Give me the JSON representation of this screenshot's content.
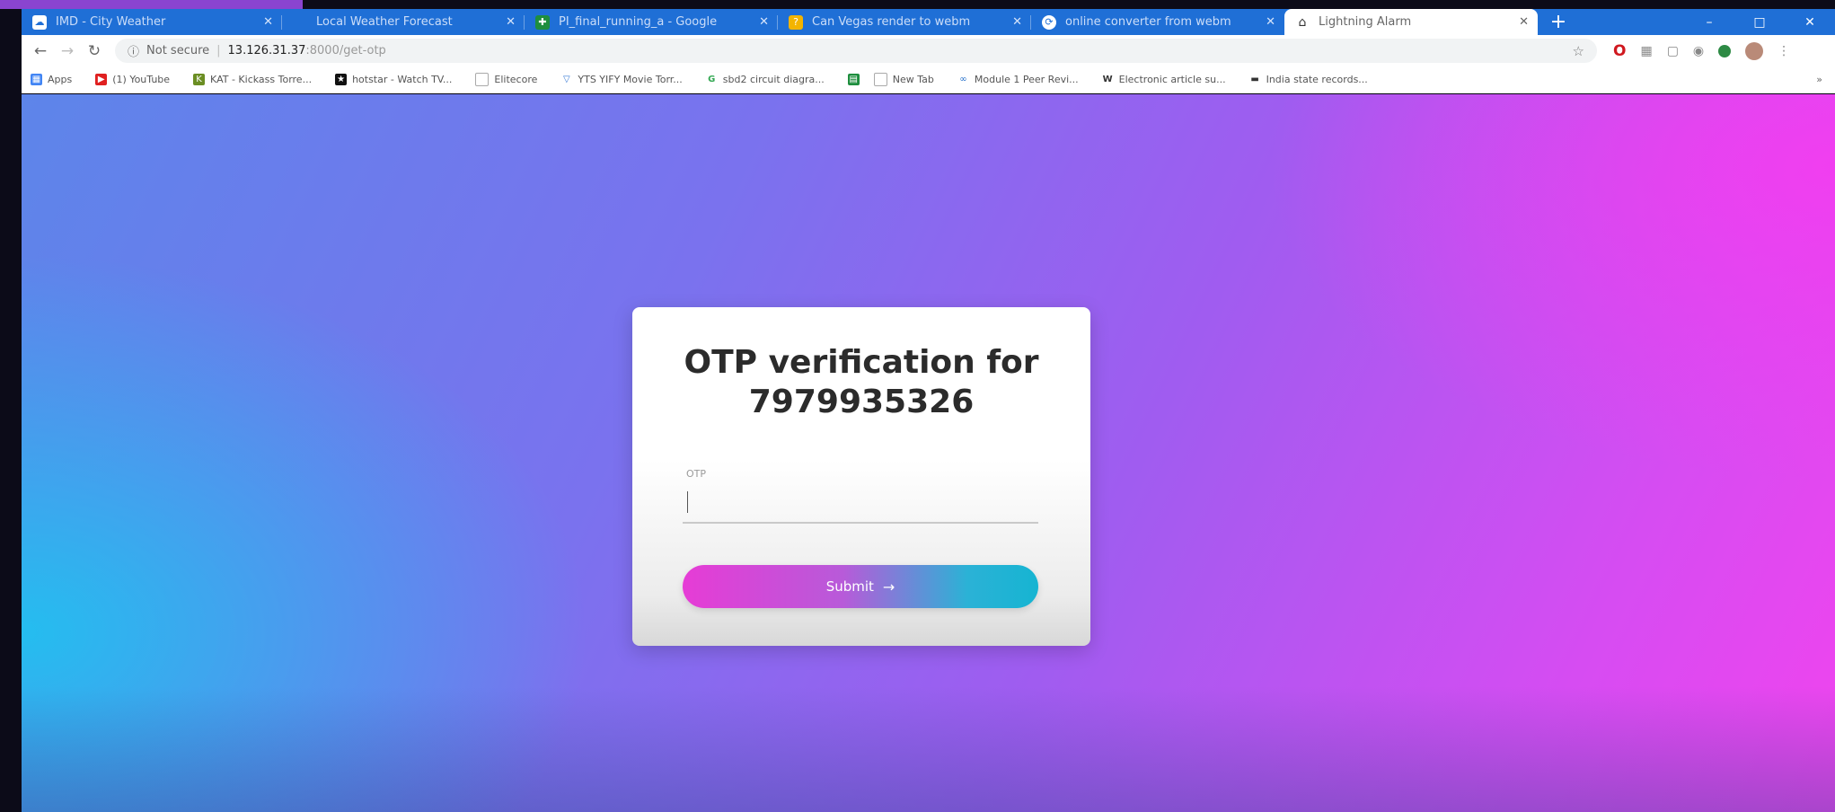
{
  "browser": {
    "tabs": [
      {
        "title": "IMD - City Weather",
        "icon": "weather-icon",
        "icon_color": "#ffffff",
        "active": false
      },
      {
        "title": "Local Weather Forecast",
        "icon": "globe-icon",
        "icon_color": "#1f6fd6",
        "active": false
      },
      {
        "title": "PI_final_running_a - Google",
        "icon": "google-sheets-icon",
        "icon_color": "#1e8e3e",
        "active": false
      },
      {
        "title": "Can Vegas render to webm",
        "icon": "forum-icon",
        "icon_color": "#f3b400",
        "active": false
      },
      {
        "title": "online converter from webm",
        "icon": "converter-icon",
        "icon_color": "#ffffff",
        "active": false
      },
      {
        "title": "Lightning Alarm",
        "icon": "home-icon",
        "icon_color": "#333333",
        "active": true
      }
    ],
    "new_tab_symbol": "+",
    "window_controls": {
      "minimize": "–",
      "maximize": "□",
      "close": "✕"
    },
    "address": {
      "security_text": "Not secure",
      "host": "13.126.31.37",
      "path": ":8000/get-otp"
    },
    "bookmarks": [
      {
        "label": "Apps",
        "icon": "apps-grid-icon",
        "color": "#4285f4"
      },
      {
        "label": "(1) YouTube",
        "icon": "youtube-icon",
        "color": "#e02020"
      },
      {
        "label": "KAT - Kickass Torre...",
        "icon": "kat-icon",
        "color": "#6b8e23"
      },
      {
        "label": "hotstar - Watch TV...",
        "icon": "hotstar-icon",
        "color": "#111111"
      },
      {
        "label": "Elitecore",
        "icon": "page-icon",
        "color": "#888888"
      },
      {
        "label": "YTS YIFY Movie Torr...",
        "icon": "yts-icon",
        "color": "#3a7bd5"
      },
      {
        "label": "sbd2 circuit diagra...",
        "icon": "google-icon",
        "color": "#34a853"
      },
      {
        "label": "",
        "icon": "sheets-icon",
        "color": "#1e8e3e"
      },
      {
        "label": "New Tab",
        "icon": "page-icon",
        "color": "#888888"
      },
      {
        "label": "Module 1 Peer Revi...",
        "icon": "coursera-icon",
        "color": "#2a73cc"
      },
      {
        "label": "Electronic article su...",
        "icon": "wikipedia-icon",
        "color": "#333333"
      },
      {
        "label": "India state records...",
        "icon": "dash-icon",
        "color": "#333333"
      }
    ],
    "bookmarks_more": "»"
  },
  "otp_page": {
    "title_line1": "OTP verification for",
    "title_line2": "7979935326",
    "field_label": "OTP",
    "field_value": "",
    "submit_label": "Submit",
    "submit_arrow": "→"
  },
  "colors": {
    "tab_strip": "#1f6fd6",
    "gradient_left": "#19c8f0",
    "gradient_right": "#f044ee",
    "button_left": "#e63cd6",
    "button_right": "#16b4d2"
  }
}
